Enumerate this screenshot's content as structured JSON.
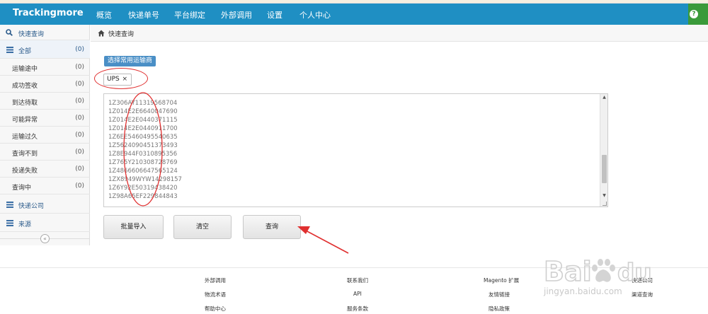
{
  "navbar": {
    "brand": "Trackingmore",
    "items": [
      "概览",
      "快递单号",
      "平台绑定",
      "外部调用",
      "设置",
      "个人中心"
    ],
    "accent": "#1f8fc3",
    "help_icon": "question-icon"
  },
  "sidebar": {
    "quick_query": "快速查询",
    "all": {
      "label": "全部",
      "count": "(0)"
    },
    "statuses": [
      {
        "label": "运输途中",
        "count": "(0)"
      },
      {
        "label": "成功签收",
        "count": "(0)"
      },
      {
        "label": "到达待取",
        "count": "(0)"
      },
      {
        "label": "可能异常",
        "count": "(0)"
      },
      {
        "label": "运输过久",
        "count": "(0)"
      },
      {
        "label": "查询不到",
        "count": "(0)"
      },
      {
        "label": "投递失败",
        "count": "(0)"
      },
      {
        "label": "查询中",
        "count": "(0)"
      }
    ],
    "express_company": "快递公司",
    "source": "来源",
    "collapse_icon": "double-chevron-left-icon"
  },
  "breadcrumb": {
    "label": "快速查询",
    "icon": "home-icon"
  },
  "main": {
    "carrier_button": "选择常用运输商",
    "selected_carrier": "UPS",
    "remove_tag": "×",
    "tracking_numbers": [
      "1Z306AY11319568704",
      "1Z014E2E6640047690",
      "1Z014E2E0440371115",
      "1Z014E2E0440911700",
      "1Z6EE5460495540635",
      "1Z5624090451373493",
      "1Z8E944F0310895356",
      "1Z765Y210308728769",
      "1Z4866606647565124",
      "1ZX8949WYW14298157",
      "1Z6Y92E50319438420",
      "1Z98A65EF229844843"
    ],
    "bulk_import": "批量导入",
    "clear": "清空",
    "query": "查询"
  },
  "footer": {
    "col1": [
      "外部调用",
      "物流术语",
      "帮助中心"
    ],
    "col2": [
      "联系我们",
      "API",
      "服务条款"
    ],
    "col3": [
      "Magento 扩展",
      "友情链接",
      "隐私政策"
    ],
    "col4": [
      "快递公司",
      "渠道查询"
    ]
  },
  "watermark": {
    "text": "Baidu经验",
    "sub": "jingyan.baidu.com"
  }
}
